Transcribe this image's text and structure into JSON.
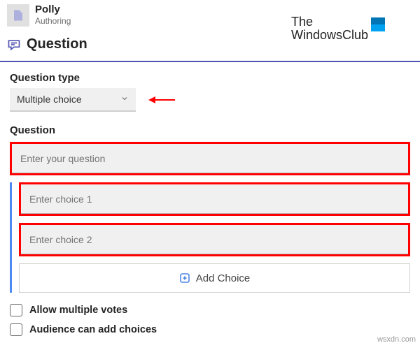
{
  "app": {
    "name": "Polly",
    "subtitle": "Authoring",
    "icon_color": "#9aa0e0"
  },
  "brand": {
    "line1": "The",
    "line2": "WindowsClub"
  },
  "section": {
    "title": "Question"
  },
  "form": {
    "question_type_label": "Question type",
    "question_type_value": "Multiple choice",
    "question_label": "Question",
    "question_placeholder": "Enter your question",
    "choices": [
      {
        "placeholder": "Enter choice 1"
      },
      {
        "placeholder": "Enter choice 2"
      }
    ],
    "add_choice_label": "Add Choice",
    "options": {
      "allow_multiple_votes": "Allow multiple votes",
      "audience_can_add": "Audience can add choices"
    }
  },
  "watermark": "wsxdn.com"
}
